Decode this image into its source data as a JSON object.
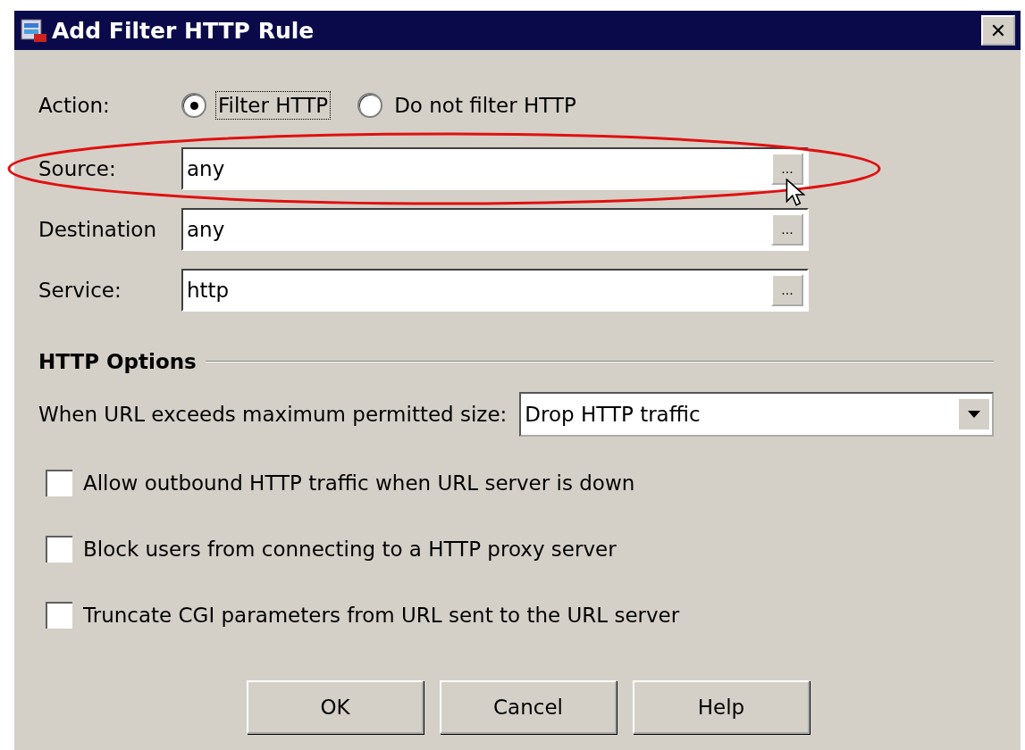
{
  "window": {
    "title": "Add Filter HTTP Rule",
    "close": "✕"
  },
  "action": {
    "label": "Action:",
    "options": [
      {
        "label": "Filter HTTP",
        "selected": true,
        "focused": true
      },
      {
        "label": "Do not filter HTTP",
        "selected": false,
        "focused": false
      }
    ]
  },
  "fields": [
    {
      "label": "Source:",
      "value": "any",
      "browse": "...",
      "highlighted": true
    },
    {
      "label": "Destination",
      "value": "any",
      "browse": "...",
      "highlighted": false
    },
    {
      "label": "Service:",
      "value": "http",
      "browse": "...",
      "highlighted": false
    }
  ],
  "http_options": {
    "title": "HTTP Options",
    "url_size_label": "When URL exceeds maximum permitted size:",
    "url_size_value": "Drop HTTP traffic",
    "checkboxes": [
      {
        "label": "Allow outbound HTTP traffic when URL server is down",
        "checked": false
      },
      {
        "label": "Block users from connecting to a HTTP proxy server",
        "checked": false
      },
      {
        "label": "Truncate CGI parameters from URL sent to the URL server",
        "checked": false
      }
    ]
  },
  "buttons": [
    "OK",
    "Cancel",
    "Help"
  ]
}
